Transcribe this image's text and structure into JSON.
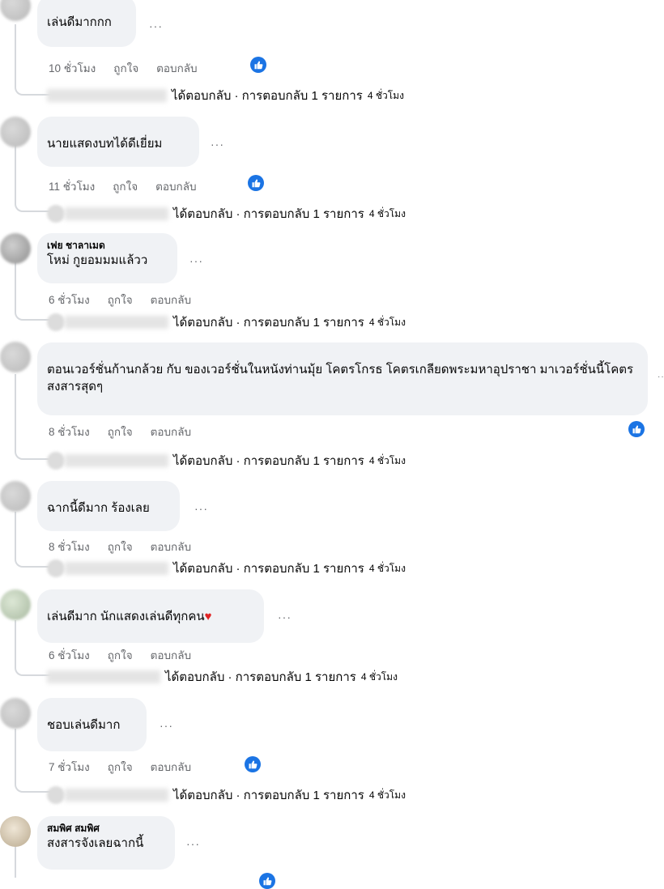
{
  "colors": {
    "like": "#1b74e4",
    "bubble": "#f0f2f5",
    "meta": "#65676b"
  },
  "labels": {
    "like": "ถูกใจ",
    "reply": "ตอบกลับ",
    "replies_text": "ได้ตอบกลับ · การตอบกลับ 1 รายการ",
    "replies_text_no_space": "ได้ตอบกลับ · การตอบกลับ 1 รายการ",
    "reply_time": "4 ชั่วโมง",
    "more": "···"
  },
  "comments": [
    {
      "text": "เล่นดีมากกก",
      "time": "10 ชั่วโมง",
      "has_like": true,
      "has_replies": true
    },
    {
      "text": "นายแสดงบทได้ดีเยี่ยม",
      "time": "11 ชั่วโมง",
      "has_like": true,
      "has_replies": true
    },
    {
      "author": "เฟย ชาลาเมด",
      "text": "โหม่ กูยอมมมแล้วว",
      "time": "6 ชั่วโมง",
      "has_like": false,
      "has_replies": true
    },
    {
      "text": "ตอนเวอร์ชั่นก้านกล้วย กับ ของเวอร์ชั่นในหนังท่านมุ้ย โคตรโกรธ โคตรเกลียดพระมหาอุปราชา มาเวอร์ชั่นนี้โคตรสงสารสุดๆ",
      "time": "8 ชั่วโมง",
      "has_like": true,
      "has_replies": true
    },
    {
      "text": "ฉากนี้ดีมาก ร้องเลย",
      "time": "8 ชั่วโมง",
      "has_like": false,
      "has_replies": true
    },
    {
      "text": "เล่นดีมาก นักแสดงเล่นดีทุกคน",
      "time": "6 ชั่วโมง",
      "has_like": false,
      "has_replies": true,
      "heart": "♥"
    },
    {
      "text": "ชอบเล่นดีมาก",
      "time": "7 ชั่วโมง",
      "has_like": true,
      "has_replies": true
    },
    {
      "author": "สมพิศ สมพิศ",
      "text": "สงสารจังเลยฉากนี้",
      "has_like": true,
      "has_replies": false
    }
  ]
}
